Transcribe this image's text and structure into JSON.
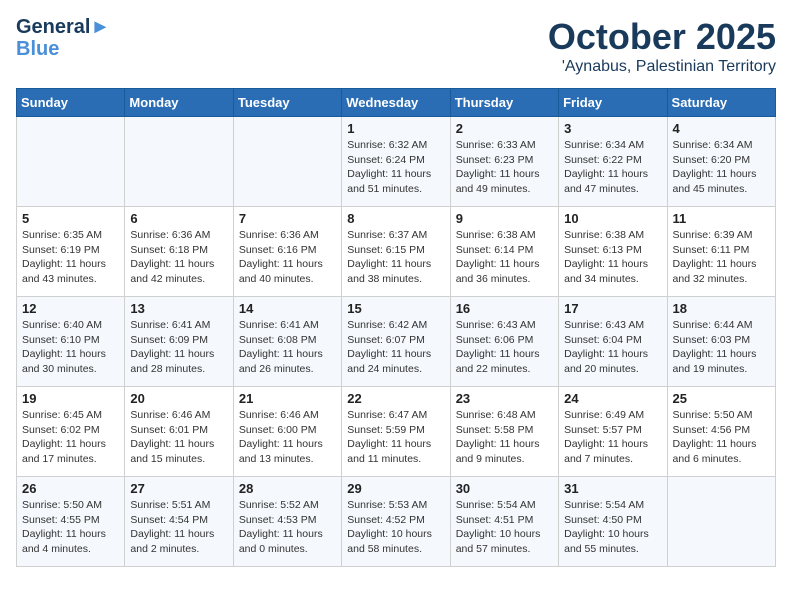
{
  "header": {
    "logo_line1": "General",
    "logo_line2": "Blue",
    "month": "October 2025",
    "location": "'Aynabus, Palestinian Territory"
  },
  "weekdays": [
    "Sunday",
    "Monday",
    "Tuesday",
    "Wednesday",
    "Thursday",
    "Friday",
    "Saturday"
  ],
  "weeks": [
    [
      {
        "day": "",
        "info": ""
      },
      {
        "day": "",
        "info": ""
      },
      {
        "day": "",
        "info": ""
      },
      {
        "day": "1",
        "info": "Sunrise: 6:32 AM\nSunset: 6:24 PM\nDaylight: 11 hours\nand 51 minutes."
      },
      {
        "day": "2",
        "info": "Sunrise: 6:33 AM\nSunset: 6:23 PM\nDaylight: 11 hours\nand 49 minutes."
      },
      {
        "day": "3",
        "info": "Sunrise: 6:34 AM\nSunset: 6:22 PM\nDaylight: 11 hours\nand 47 minutes."
      },
      {
        "day": "4",
        "info": "Sunrise: 6:34 AM\nSunset: 6:20 PM\nDaylight: 11 hours\nand 45 minutes."
      }
    ],
    [
      {
        "day": "5",
        "info": "Sunrise: 6:35 AM\nSunset: 6:19 PM\nDaylight: 11 hours\nand 43 minutes."
      },
      {
        "day": "6",
        "info": "Sunrise: 6:36 AM\nSunset: 6:18 PM\nDaylight: 11 hours\nand 42 minutes."
      },
      {
        "day": "7",
        "info": "Sunrise: 6:36 AM\nSunset: 6:16 PM\nDaylight: 11 hours\nand 40 minutes."
      },
      {
        "day": "8",
        "info": "Sunrise: 6:37 AM\nSunset: 6:15 PM\nDaylight: 11 hours\nand 38 minutes."
      },
      {
        "day": "9",
        "info": "Sunrise: 6:38 AM\nSunset: 6:14 PM\nDaylight: 11 hours\nand 36 minutes."
      },
      {
        "day": "10",
        "info": "Sunrise: 6:38 AM\nSunset: 6:13 PM\nDaylight: 11 hours\nand 34 minutes."
      },
      {
        "day": "11",
        "info": "Sunrise: 6:39 AM\nSunset: 6:11 PM\nDaylight: 11 hours\nand 32 minutes."
      }
    ],
    [
      {
        "day": "12",
        "info": "Sunrise: 6:40 AM\nSunset: 6:10 PM\nDaylight: 11 hours\nand 30 minutes."
      },
      {
        "day": "13",
        "info": "Sunrise: 6:41 AM\nSunset: 6:09 PM\nDaylight: 11 hours\nand 28 minutes."
      },
      {
        "day": "14",
        "info": "Sunrise: 6:41 AM\nSunset: 6:08 PM\nDaylight: 11 hours\nand 26 minutes."
      },
      {
        "day": "15",
        "info": "Sunrise: 6:42 AM\nSunset: 6:07 PM\nDaylight: 11 hours\nand 24 minutes."
      },
      {
        "day": "16",
        "info": "Sunrise: 6:43 AM\nSunset: 6:06 PM\nDaylight: 11 hours\nand 22 minutes."
      },
      {
        "day": "17",
        "info": "Sunrise: 6:43 AM\nSunset: 6:04 PM\nDaylight: 11 hours\nand 20 minutes."
      },
      {
        "day": "18",
        "info": "Sunrise: 6:44 AM\nSunset: 6:03 PM\nDaylight: 11 hours\nand 19 minutes."
      }
    ],
    [
      {
        "day": "19",
        "info": "Sunrise: 6:45 AM\nSunset: 6:02 PM\nDaylight: 11 hours\nand 17 minutes."
      },
      {
        "day": "20",
        "info": "Sunrise: 6:46 AM\nSunset: 6:01 PM\nDaylight: 11 hours\nand 15 minutes."
      },
      {
        "day": "21",
        "info": "Sunrise: 6:46 AM\nSunset: 6:00 PM\nDaylight: 11 hours\nand 13 minutes."
      },
      {
        "day": "22",
        "info": "Sunrise: 6:47 AM\nSunset: 5:59 PM\nDaylight: 11 hours\nand 11 minutes."
      },
      {
        "day": "23",
        "info": "Sunrise: 6:48 AM\nSunset: 5:58 PM\nDaylight: 11 hours\nand 9 minutes."
      },
      {
        "day": "24",
        "info": "Sunrise: 6:49 AM\nSunset: 5:57 PM\nDaylight: 11 hours\nand 7 minutes."
      },
      {
        "day": "25",
        "info": "Sunrise: 5:50 AM\nSunset: 4:56 PM\nDaylight: 11 hours\nand 6 minutes."
      }
    ],
    [
      {
        "day": "26",
        "info": "Sunrise: 5:50 AM\nSunset: 4:55 PM\nDaylight: 11 hours\nand 4 minutes."
      },
      {
        "day": "27",
        "info": "Sunrise: 5:51 AM\nSunset: 4:54 PM\nDaylight: 11 hours\nand 2 minutes."
      },
      {
        "day": "28",
        "info": "Sunrise: 5:52 AM\nSunset: 4:53 PM\nDaylight: 11 hours\nand 0 minutes."
      },
      {
        "day": "29",
        "info": "Sunrise: 5:53 AM\nSunset: 4:52 PM\nDaylight: 10 hours\nand 58 minutes."
      },
      {
        "day": "30",
        "info": "Sunrise: 5:54 AM\nSunset: 4:51 PM\nDaylight: 10 hours\nand 57 minutes."
      },
      {
        "day": "31",
        "info": "Sunrise: 5:54 AM\nSunset: 4:50 PM\nDaylight: 10 hours\nand 55 minutes."
      },
      {
        "day": "",
        "info": ""
      }
    ]
  ]
}
